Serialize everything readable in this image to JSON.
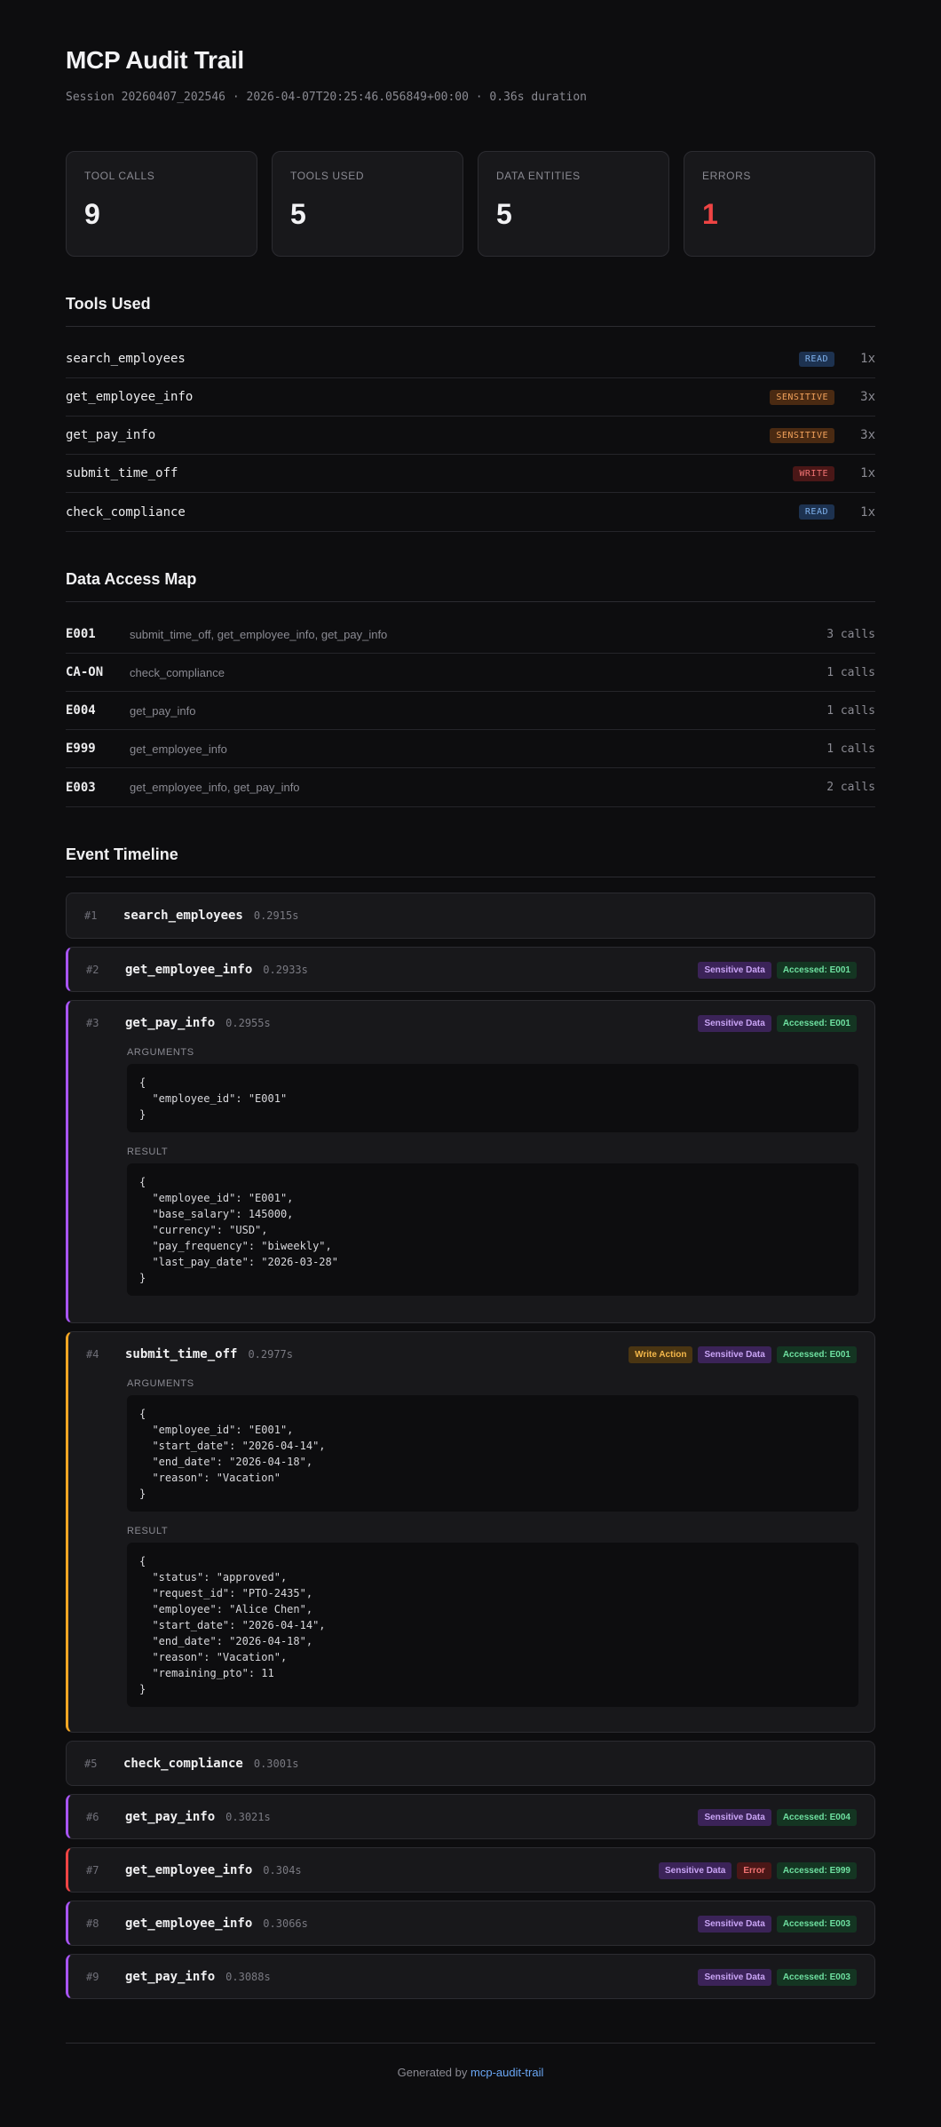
{
  "header": {
    "title": "MCP Audit Trail",
    "subtitle": "Session 20260407_202546 · 2026-04-07T20:25:46.056849+00:00 · 0.36s duration"
  },
  "stats": [
    {
      "label": "TOOL CALLS",
      "value": "9"
    },
    {
      "label": "TOOLS USED",
      "value": "5"
    },
    {
      "label": "DATA ENTITIES",
      "value": "5"
    },
    {
      "label": "ERRORS",
      "value": "1"
    }
  ],
  "tools_used": {
    "title": "Tools Used",
    "items": [
      {
        "name": "search_employees",
        "tag": "READ",
        "count": "1x"
      },
      {
        "name": "get_employee_info",
        "tag": "SENSITIVE",
        "count": "3x"
      },
      {
        "name": "get_pay_info",
        "tag": "SENSITIVE",
        "count": "3x"
      },
      {
        "name": "submit_time_off",
        "tag": "WRITE",
        "count": "1x"
      },
      {
        "name": "check_compliance",
        "tag": "READ",
        "count": "1x"
      }
    ]
  },
  "data_access": {
    "title": "Data Access Map",
    "items": [
      {
        "entity": "E001",
        "tools": "submit_time_off, get_employee_info, get_pay_info",
        "calls": "3 calls"
      },
      {
        "entity": "CA-ON",
        "tools": "check_compliance",
        "calls": "1 calls"
      },
      {
        "entity": "E004",
        "tools": "get_pay_info",
        "calls": "1 calls"
      },
      {
        "entity": "E999",
        "tools": "get_employee_info",
        "calls": "1 calls"
      },
      {
        "entity": "E003",
        "tools": "get_employee_info, get_pay_info",
        "calls": "2 calls"
      }
    ]
  },
  "timeline": {
    "title": "Event Timeline",
    "arguments_label": "ARGUMENTS",
    "result_label": "RESULT",
    "events": [
      {
        "num": "#1",
        "name": "search_employees",
        "time": "0.2915s",
        "badges": []
      },
      {
        "num": "#2",
        "name": "get_employee_info",
        "time": "0.2933s",
        "badges": [
          "Sensitive Data",
          "Accessed: E001"
        ]
      },
      {
        "num": "#3",
        "name": "get_pay_info",
        "time": "0.2955s",
        "badges": [
          "Sensitive Data",
          "Accessed: E001"
        ],
        "arguments": "{\n  \"employee_id\": \"E001\"\n}",
        "result": "{\n  \"employee_id\": \"E001\",\n  \"base_salary\": 145000,\n  \"currency\": \"USD\",\n  \"pay_frequency\": \"biweekly\",\n  \"last_pay_date\": \"2026-03-28\"\n}"
      },
      {
        "num": "#4",
        "name": "submit_time_off",
        "time": "0.2977s",
        "badges": [
          "Write Action",
          "Sensitive Data",
          "Accessed: E001"
        ],
        "arguments": "{\n  \"employee_id\": \"E001\",\n  \"start_date\": \"2026-04-14\",\n  \"end_date\": \"2026-04-18\",\n  \"reason\": \"Vacation\"\n}",
        "result": "{\n  \"status\": \"approved\",\n  \"request_id\": \"PTO-2435\",\n  \"employee\": \"Alice Chen\",\n  \"start_date\": \"2026-04-14\",\n  \"end_date\": \"2026-04-18\",\n  \"reason\": \"Vacation\",\n  \"remaining_pto\": 11\n}"
      },
      {
        "num": "#5",
        "name": "check_compliance",
        "time": "0.3001s",
        "badges": []
      },
      {
        "num": "#6",
        "name": "get_pay_info",
        "time": "0.3021s",
        "badges": [
          "Sensitive Data",
          "Accessed: E004"
        ]
      },
      {
        "num": "#7",
        "name": "get_employee_info",
        "time": "0.304s",
        "badges": [
          "Sensitive Data",
          "Error",
          "Accessed: E999"
        ]
      },
      {
        "num": "#8",
        "name": "get_employee_info",
        "time": "0.3066s",
        "badges": [
          "Sensitive Data",
          "Accessed: E003"
        ]
      },
      {
        "num": "#9",
        "name": "get_pay_info",
        "time": "0.3088s",
        "badges": [
          "Sensitive Data",
          "Accessed: E003"
        ]
      }
    ]
  },
  "footer": {
    "prefix": "Generated by",
    "link": "mcp-audit-trail"
  }
}
